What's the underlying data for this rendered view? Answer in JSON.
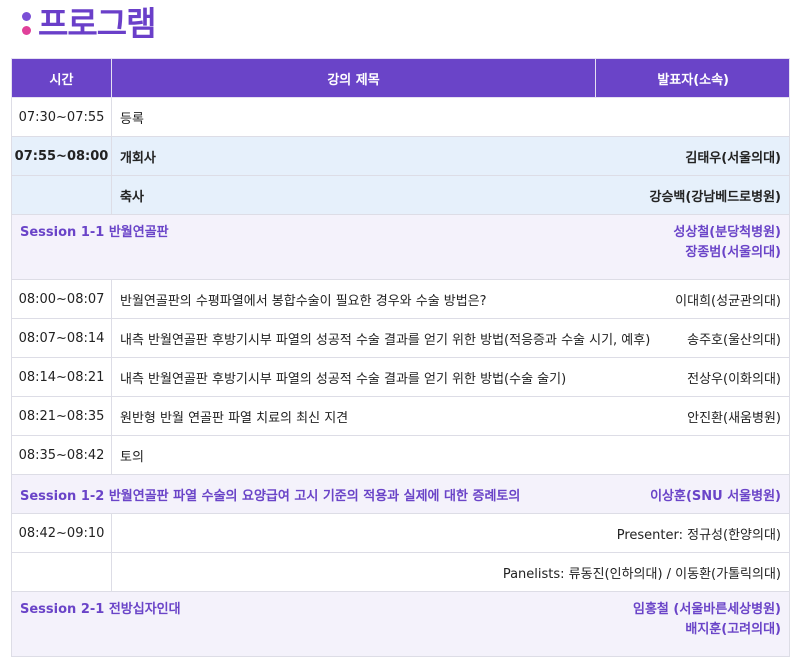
{
  "page": {
    "title": "프로그램"
  },
  "table": {
    "headers": {
      "time": "시간",
      "lecture": "강의 제목",
      "speaker": "발표자(소속)"
    },
    "rows": [
      {
        "time": "07:30~07:55",
        "title": "등록",
        "speaker": ""
      },
      {
        "time": "07:55~08:00",
        "title": "개회사",
        "speaker": "김태우(서울의대)"
      },
      {
        "time": "",
        "title": "축사",
        "speaker": "강승백(강남베드로병원)"
      },
      {
        "session": "Session 1-1 반월연골판",
        "chairs": [
          "성상철(분당척병원)",
          "장종범(서울의대)"
        ]
      },
      {
        "time": "08:00~08:07",
        "title": "반월연골판의 수평파열에서 봉합수술이 필요한 경우와 수술 방법은?",
        "speaker": "이대희(성균관의대)"
      },
      {
        "time": "08:07~08:14",
        "title": "내측 반월연골판 후방기시부 파열의 성공적 수술 결과를 얻기 위한 방법(적응증과 수술 시기, 예후)",
        "speaker": "송주호(울산의대)"
      },
      {
        "time": "08:14~08:21",
        "title": "내측 반월연골판 후방기시부 파열의 성공적 수술 결과를 얻기 위한 방법(수술 술기)",
        "speaker": "전상우(이화의대)"
      },
      {
        "time": "08:21~08:35",
        "title": "원반형 반월 연골판 파열 치료의 최신 지견",
        "speaker": "안진환(새움병원)"
      },
      {
        "time": "08:35~08:42",
        "title": "토의",
        "speaker": ""
      },
      {
        "session": "Session 1-2 반월연골판 파열 수술의 요양급여 고시 기준의 적용과 실제에 대한 증례토의",
        "chairs": [
          "이상훈(SNU 서울병원)"
        ]
      },
      {
        "time": "08:42~09:10",
        "title": "",
        "speaker": "Presenter: 정규성(한양의대)"
      },
      {
        "time": "",
        "title": "",
        "speaker": "Panelists: 류동진(인하의대) / 이동환(가톨릭의대)"
      },
      {
        "session": "Session 2-1 전방십자인대",
        "chairs": [
          "임홍철 (서울바른세상병원)",
          "배지훈(고려의대)"
        ]
      }
    ]
  }
}
